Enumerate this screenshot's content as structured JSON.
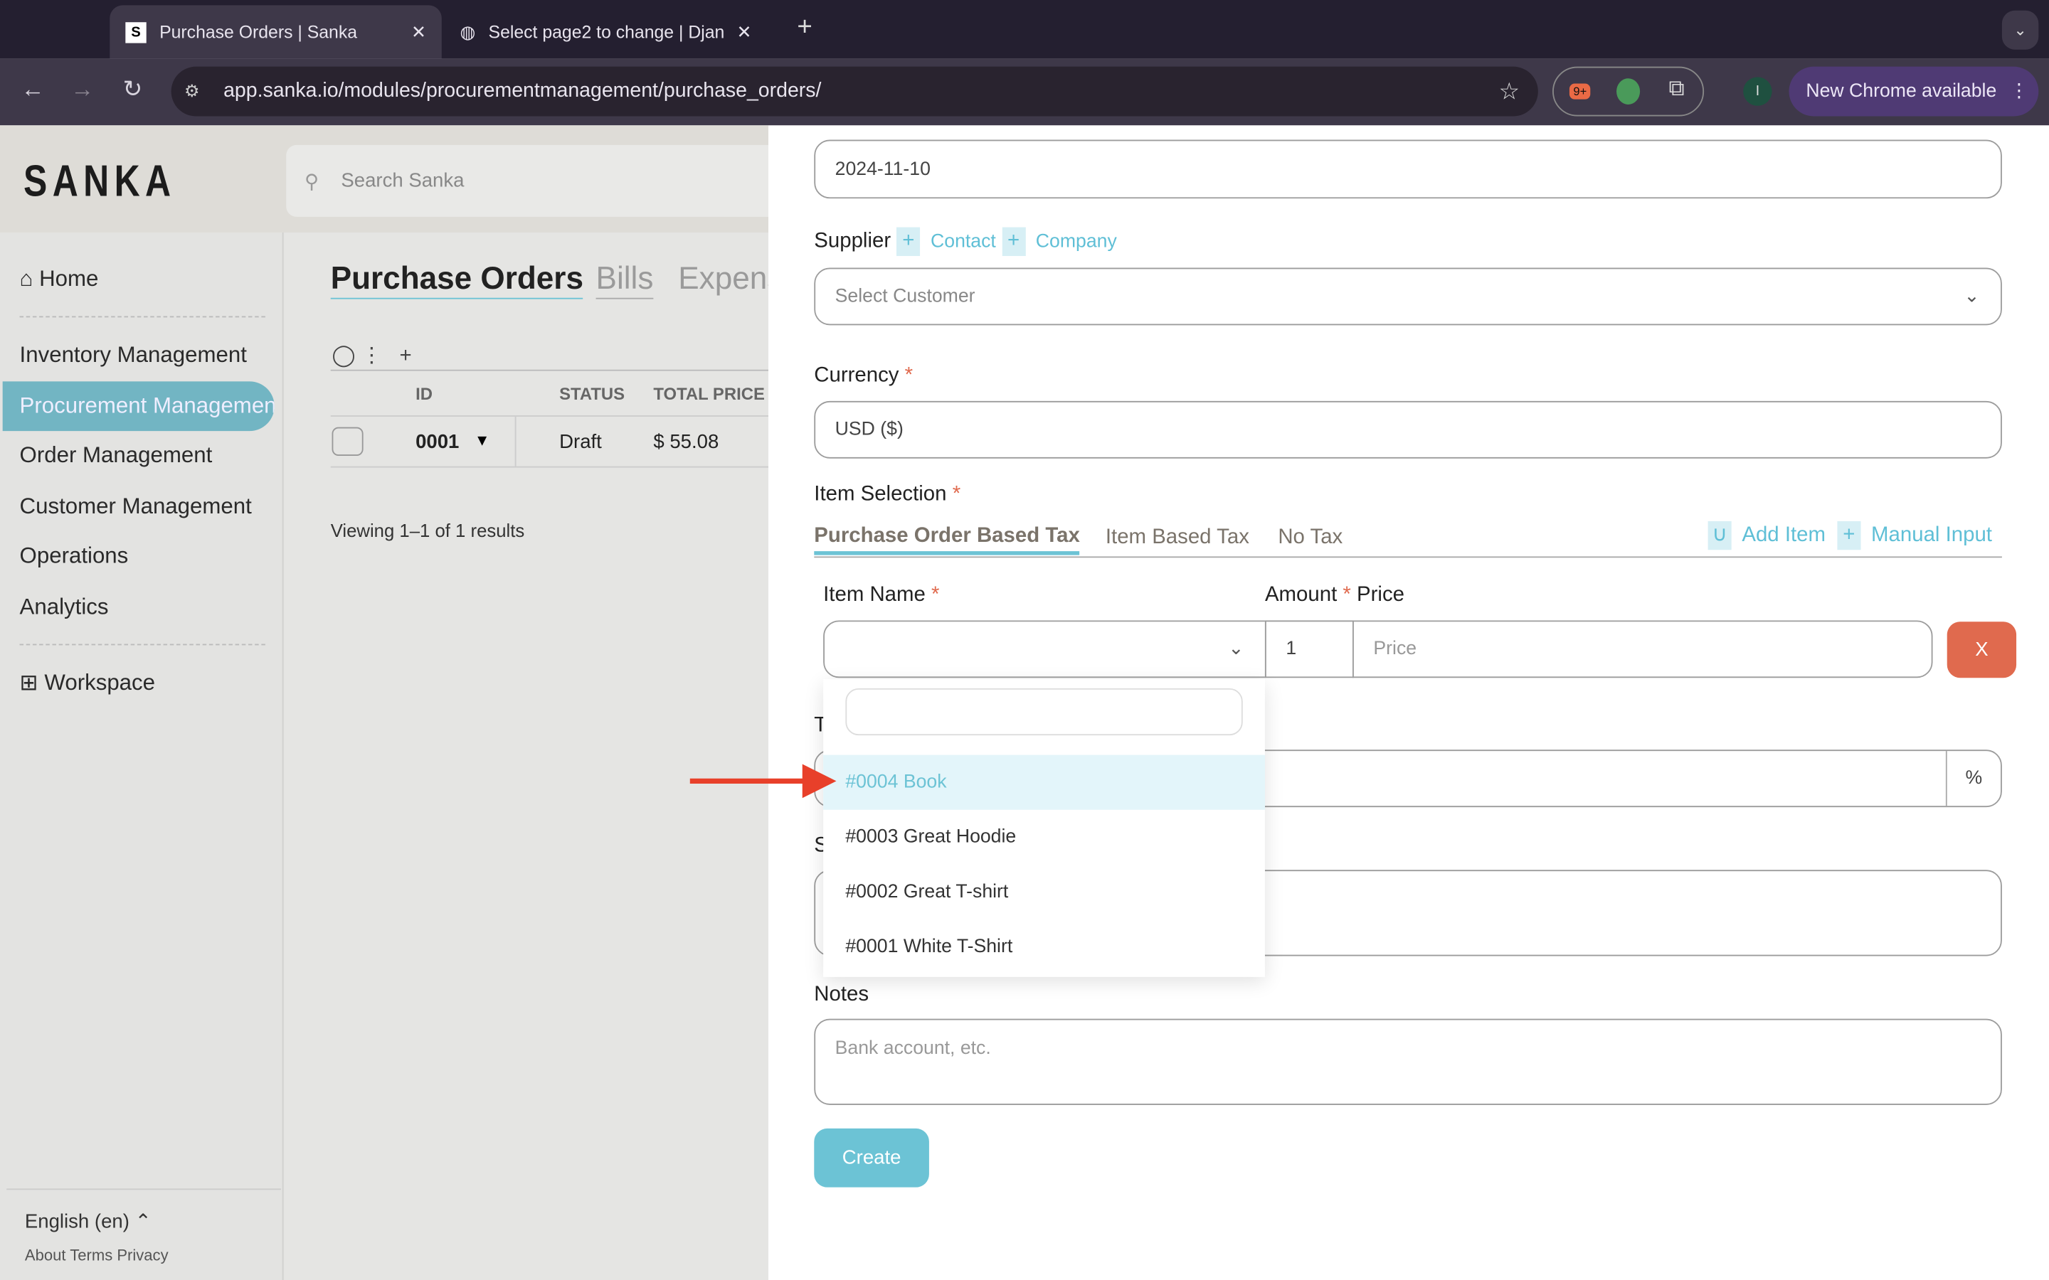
{
  "browser": {
    "tabs": [
      {
        "title": "Purchase Orders | Sanka",
        "favicon": "S"
      },
      {
        "title": "Select page2 to change | Djan"
      }
    ],
    "url": "app.sanka.io/modules/procurementmanagement/purchase_orders/",
    "extension_badge": "9+",
    "profile_initial": "I",
    "new_chrome": "New Chrome available"
  },
  "app": {
    "logo": "SANKA",
    "search_placeholder": "Search Sanka",
    "sidebar": {
      "items": [
        {
          "label": "Home"
        },
        {
          "label": "Inventory Management"
        },
        {
          "label": "Procurement Management"
        },
        {
          "label": "Order Management"
        },
        {
          "label": "Customer Management"
        },
        {
          "label": "Operations"
        },
        {
          "label": "Analytics"
        },
        {
          "label": "Workspace"
        }
      ],
      "language": "English (en)",
      "footer_links": "About Terms Privacy"
    },
    "page_tabs": [
      "Purchase Orders",
      "Bills",
      "Expens"
    ],
    "table": {
      "headers": [
        "ID",
        "STATUS",
        "TOTAL PRICE"
      ],
      "rows": [
        {
          "id": "0001",
          "status": "Draft",
          "total": "$ 55.08"
        }
      ],
      "viewing": "Viewing 1–1 of 1 results"
    }
  },
  "form": {
    "date": "2024-11-10",
    "supplier_label": "Supplier",
    "contact_link": "Contact",
    "company_link": "Company",
    "customer_placeholder": "Select Customer",
    "currency_label": "Currency",
    "currency_value": "USD ($)",
    "item_selection_label": "Item Selection",
    "tax_tabs": [
      "Purchase Order Based Tax",
      "Item Based Tax",
      "No Tax"
    ],
    "add_item": "Add Item",
    "manual_input": "Manual Input",
    "item_name_label": "Item Name",
    "amount_label": "Amount",
    "price_label": "Price",
    "amount_value": "1",
    "price_placeholder": "Price",
    "remove_label": "X",
    "percent": "%",
    "notes_label": "Notes",
    "notes_placeholder": "Bank account, etc.",
    "create": "Create",
    "partial_t": "T",
    "partial_s": "S",
    "dropdown_options": [
      "#0004 Book",
      "#0003 Great Hoodie",
      "#0002 Great T-shirt",
      "#0001 White T-Shirt"
    ]
  },
  "colors": {
    "accent": "#6cc3d5",
    "danger": "#e06a4e",
    "arrow": "#e8402a"
  }
}
